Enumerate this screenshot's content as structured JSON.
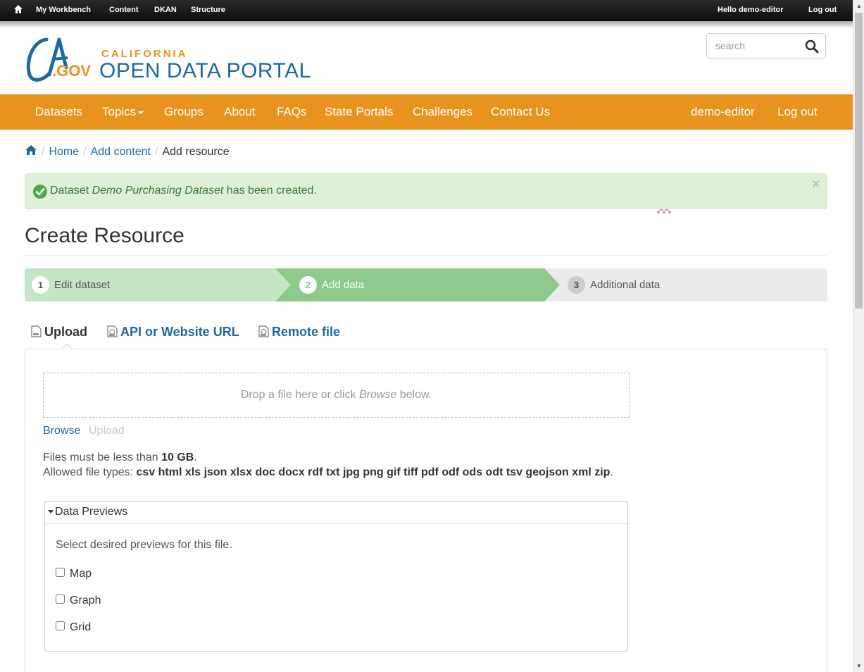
{
  "admin_bar": {
    "items": [
      "My Workbench",
      "Content",
      "DKAN",
      "Structure"
    ],
    "greeting": "Hello ",
    "username": "demo-editor",
    "logout": "Log out"
  },
  "header": {
    "logo_text_ca": "CA",
    "logo_text_gov": ".GOV",
    "site_state": "CALIFORNIA",
    "site_name": "OPEN DATA PORTAL",
    "search_placeholder": "search"
  },
  "nav": {
    "links": [
      "Datasets",
      "Topics",
      "Groups",
      "About",
      "FAQs",
      "State Portals",
      "Challenges",
      "Contact Us"
    ],
    "user": "demo-editor",
    "logout": "Log out"
  },
  "breadcrumb": {
    "items": [
      "Home",
      "Add content"
    ],
    "current": "Add resource"
  },
  "alert": {
    "prefix": "Dataset ",
    "dataset_name": "Demo Purchasing Dataset",
    "suffix": " has been created.",
    "close": "×"
  },
  "page": {
    "title": "Create Resource"
  },
  "steps": [
    {
      "number": "1",
      "label": "Edit dataset"
    },
    {
      "number": "2",
      "label": "Add data"
    },
    {
      "number": "3",
      "label": "Additional data"
    }
  ],
  "tabs": [
    "Upload",
    "API or Website URL",
    "Remote file"
  ],
  "upload": {
    "drop_prefix": "Drop a file here or click ",
    "drop_browse": "Browse",
    "drop_suffix": " below.",
    "browse": "Browse",
    "upload": "Upload",
    "size_prefix": "Files must be less than ",
    "size_value": "10 GB",
    "size_suffix": ".",
    "types_prefix": "Allowed file types: ",
    "types_value": "csv html xls json xlsx doc docx rdf txt jpg png gif tiff pdf odf ods odt tsv geojson xml zip",
    "types_suffix": "."
  },
  "previews": {
    "legend": "Data Previews",
    "description": "Select desired previews for this file.",
    "options": [
      "Map",
      "Graph",
      "Grid"
    ]
  },
  "colors": {
    "brand_orange": "#e8931e",
    "brand_blue": "#1c6aa0",
    "step_light": "#c5e6c4",
    "step_active": "#8dc98a",
    "alert_bg": "#dff0d8"
  }
}
